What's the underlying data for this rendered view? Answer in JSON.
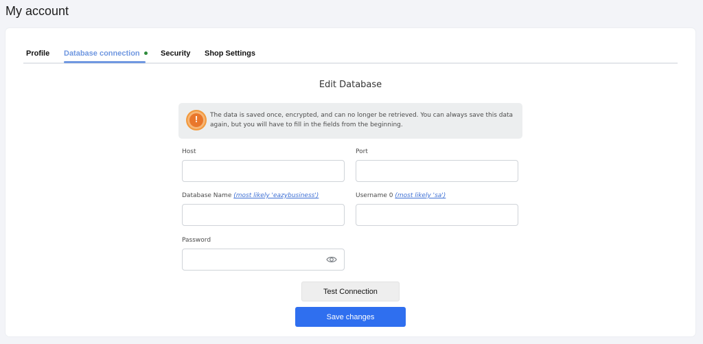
{
  "page": {
    "title": "My account"
  },
  "tabs": [
    {
      "label": "Profile",
      "active": false
    },
    {
      "label": "Database connection",
      "active": true,
      "status": "connected"
    },
    {
      "label": "Security",
      "active": false
    },
    {
      "label": "Shop Settings",
      "active": false
    }
  ],
  "form": {
    "title": "Edit Database",
    "notice": {
      "icon": "warning-icon",
      "icon_glyph": "!",
      "text": "The data is saved once, encrypted, and can no longer be retrieved. You can always save this data again, but you will have to fill in the fields from the beginning."
    },
    "fields": {
      "host": {
        "label": "Host",
        "value": "",
        "placeholder": ""
      },
      "port": {
        "label": "Port",
        "value": "",
        "placeholder": ""
      },
      "database_name": {
        "label": "Database Name",
        "hint": "(most likely 'eazybusiness')",
        "value": "",
        "placeholder": ""
      },
      "username": {
        "label": "Username 0",
        "hint": "(most likely 'sa')",
        "value": "",
        "placeholder": ""
      },
      "password": {
        "label": "Password",
        "value": "",
        "placeholder": "",
        "toggle_icon": "eye-icon"
      }
    },
    "buttons": {
      "test_connection": "Test Connection",
      "save": "Save changes"
    }
  },
  "colors": {
    "accent": "#6f97e0",
    "primary_button": "#2f6fef",
    "status_connected": "#2e8b3b",
    "warning": "#e9772b"
  }
}
